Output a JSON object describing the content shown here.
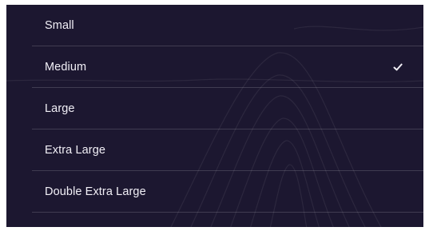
{
  "menu": {
    "items": [
      {
        "label": "Small",
        "selected": false
      },
      {
        "label": "Medium",
        "selected": true
      },
      {
        "label": "Large",
        "selected": false
      },
      {
        "label": "Extra Large",
        "selected": false
      },
      {
        "label": "Double Extra Large",
        "selected": false
      }
    ],
    "selected_icon": "checkmark-icon"
  },
  "colors": {
    "background": "#1c1730",
    "text": "#f1eff6",
    "divider": "rgba(255,255,255,0.16)",
    "contour": "rgba(255,255,255,0.07)"
  }
}
